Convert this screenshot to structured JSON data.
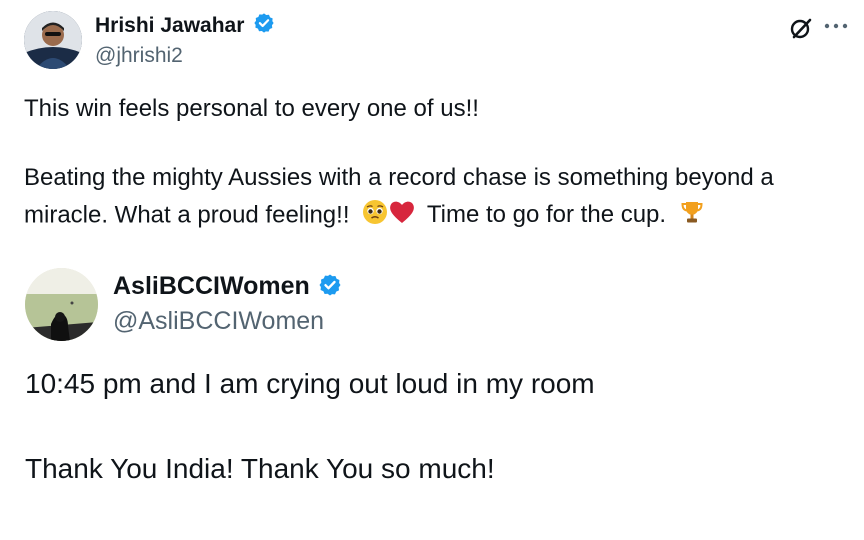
{
  "primary_post": {
    "author_name": "Hrishi Jawahar",
    "author_handle": "@jhrishi2",
    "verified": true,
    "line1": "This win feels personal to every one of us!!",
    "line2": "Beating the mighty Aussies with a record chase is something beyond a",
    "line3_part1": "miracle. What a proud feeling!!",
    "line3_part2": "Time to go for the cup.",
    "emojis": [
      "pleading-face",
      "red-heart",
      "trophy"
    ]
  },
  "quoted_post": {
    "author_name": "AsliBCCIWomen",
    "author_handle": "@AsliBCCIWomen",
    "verified": true,
    "line1": "10:45 pm and I am crying out loud in my room",
    "line2": "Thank You India! Thank You so much!"
  },
  "header_actions": {
    "grok_icon": "grok-slash-icon",
    "more_icon": "more-ellipsis-icon"
  },
  "colors": {
    "verified_blue": "#1d9bf0",
    "text": "#0f1419",
    "secondary_text": "#536471"
  }
}
